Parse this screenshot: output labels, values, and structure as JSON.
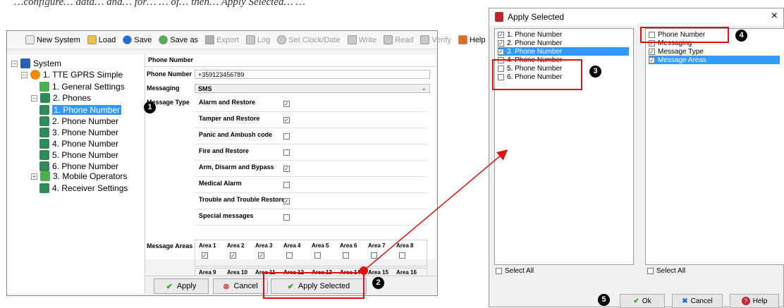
{
  "caption": "…configure… data… and… for… … of… then… Apply Selected… …",
  "toolbar": {
    "items": [
      {
        "label": "New System",
        "icon": "new-doc-icon",
        "enabled": true
      },
      {
        "label": "Load",
        "icon": "folder-icon",
        "enabled": true
      },
      {
        "label": "Save",
        "icon": "save-icon",
        "enabled": true
      },
      {
        "label": "Save as",
        "icon": "save-as-icon",
        "enabled": true
      },
      {
        "label": "Export",
        "icon": "export-icon",
        "enabled": false
      },
      {
        "label": "Log",
        "icon": "log-icon",
        "enabled": false
      },
      {
        "label": "Set Clock/Date",
        "icon": "clock-icon",
        "enabled": false
      },
      {
        "label": "Write",
        "icon": "write-icon",
        "enabled": false
      },
      {
        "label": "Read",
        "icon": "read-icon",
        "enabled": false
      },
      {
        "label": "Verify",
        "icon": "verify-icon",
        "enabled": false
      },
      {
        "label": "Help",
        "icon": "help-icon",
        "enabled": true
      }
    ]
  },
  "tree": {
    "system": "System",
    "device": "1. TTE GPRS Simple",
    "general": "1. General Settings",
    "phones": "2. Phones",
    "phone_items": [
      "1. Phone Number",
      "2. Phone Number",
      "3. Phone Number",
      "4. Phone Number",
      "5. Phone Number",
      "6. Phone Number"
    ],
    "mobile": "3. Mobile Operators",
    "receiver": "4. Receiver Settings"
  },
  "form": {
    "section_title": "Phone Number",
    "phone_label": "Phone Number",
    "phone_value": "+359123456789",
    "messaging_label": "Messaging",
    "messaging_value": "SMS",
    "message_type_label": "Message Type",
    "message_types": [
      {
        "label": "Alarm and Restore",
        "checked": true
      },
      {
        "label": "Tamper and Restore",
        "checked": true
      },
      {
        "label": "Panic and Ambush code",
        "checked": false
      },
      {
        "label": "Fire and Restore",
        "checked": false
      },
      {
        "label": "Arm, Disarm and Bypass",
        "checked": true
      },
      {
        "label": "Medical Alarm",
        "checked": false
      },
      {
        "label": "Trouble and Trouble Restore",
        "checked": true
      },
      {
        "label": "Special messages",
        "checked": false
      }
    ],
    "message_areas_label": "Message Areas",
    "areas_row1": [
      {
        "label": "Area 1",
        "checked": true
      },
      {
        "label": "Area 2",
        "checked": true
      },
      {
        "label": "Area 3",
        "checked": true
      },
      {
        "label": "Area 4",
        "checked": false
      },
      {
        "label": "Area 5",
        "checked": false
      },
      {
        "label": "Area 6",
        "checked": false
      },
      {
        "label": "Area 7",
        "checked": false
      },
      {
        "label": "Area 8",
        "checked": false
      }
    ],
    "areas_row2": [
      {
        "label": "Area 9",
        "checked": false
      },
      {
        "label": "Area 10",
        "checked": false
      },
      {
        "label": "Area 11",
        "checked": false
      },
      {
        "label": "Area 12",
        "checked": false
      },
      {
        "label": "Area 13",
        "checked": false
      },
      {
        "label": "Area 14",
        "checked": false
      },
      {
        "label": "Area 15",
        "checked": false
      },
      {
        "label": "Area 16",
        "checked": false
      }
    ]
  },
  "buttons": {
    "apply": "Apply",
    "cancel": "Cancel",
    "apply_selected": "Apply Selected"
  },
  "dialog": {
    "title": "Apply Selected",
    "close": "×",
    "left_items": [
      {
        "label": "1. Phone Number",
        "checked": true,
        "selected": false
      },
      {
        "label": "2. Phone Number",
        "checked": true,
        "selected": false
      },
      {
        "label": "3. Phone Number",
        "checked": true,
        "selected": true
      },
      {
        "label": "4. Phone Number",
        "checked": false,
        "selected": false
      },
      {
        "label": "5. Phone Number",
        "checked": false,
        "selected": false
      },
      {
        "label": "6. Phone Number",
        "checked": false,
        "selected": false
      }
    ],
    "right_items": [
      {
        "label": "Phone Number",
        "checked": false,
        "selected": false
      },
      {
        "label": "Messaging",
        "checked": true,
        "selected": false
      },
      {
        "label": "Message Type",
        "checked": true,
        "selected": false
      },
      {
        "label": "Message Areas",
        "checked": true,
        "selected": true
      }
    ],
    "select_all_left": "Select All",
    "select_all_right": "Select All",
    "ok": "Ok",
    "cancel": "Cancel",
    "help": "Help"
  },
  "markers": [
    "1",
    "2",
    "3",
    "4",
    "5"
  ],
  "colors": {
    "selection": "#3399ff",
    "highlight": "#e01010",
    "ok_green": "#2e9e2e",
    "cancel_blue": "#1e6fd9",
    "help_red": "#c0262d"
  }
}
